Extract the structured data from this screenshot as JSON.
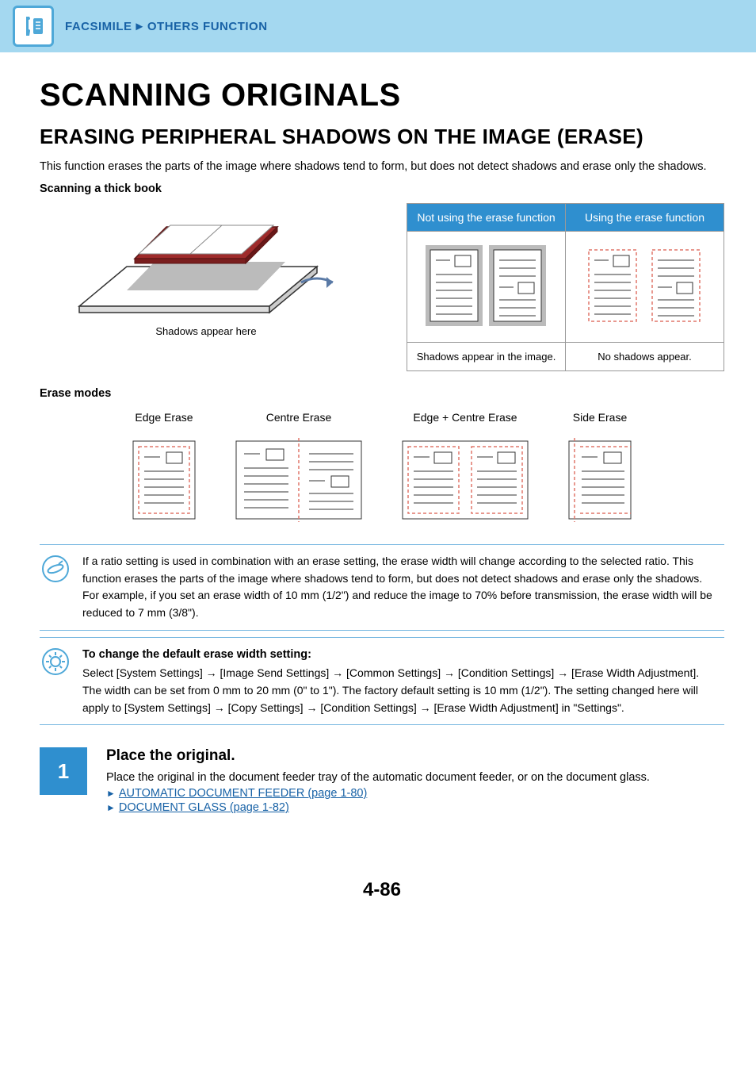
{
  "header": {
    "breadcrumb_section": "FACSIMILE",
    "breadcrumb_sep": "►",
    "breadcrumb_sub": "OTHERS FUNCTION"
  },
  "title_main": "SCANNING ORIGINALS",
  "title_sub": "ERASING PERIPHERAL SHADOWS ON THE IMAGE (ERASE)",
  "intro_paragraph": "This function erases the parts of the image where shadows tend to form, but does not detect shadows and erase only the shadows.",
  "scanning_caption": "Scanning a thick book",
  "book_caption": "Shadows appear here",
  "compare": {
    "col_a_title": "Not using the erase function",
    "col_b_title": "Using the erase function",
    "col_a_caption": "Shadows appear in the image.",
    "col_b_caption": "No shadows appear."
  },
  "erase_modes_label": "Erase modes",
  "modes": {
    "edge": "Edge Erase",
    "centre": "Centre Erase",
    "edge_centre": "Edge + Centre Erase",
    "side": "Side Erase"
  },
  "note1": {
    "p1": "If a ratio setting is used in combination with an erase setting, the erase width will change according to the selected ratio. This function erases the parts of the image where shadows tend to form, but does not detect shadows and erase only the shadows.",
    "p2": "For example, if you set an erase width of 10 mm (1/2\") and reduce the image to 70% before transmission, the erase width will be reduced to 7 mm (3/8\")."
  },
  "note2": {
    "heading": "To change the default erase width setting:",
    "p1": "Select [System Settings] → [Image Send Settings] → [Common Settings] → [Condition Settings] → [Erase Width Adjustment].",
    "p2": "The width can be set from 0 mm to 20 mm (0\" to 1\"). The factory default setting is 10 mm (1/2\"). The setting changed here will apply to [System Settings] → [Copy Settings] → [Condition Settings] → [Erase Width Adjustment] in \"Settings\"."
  },
  "step1": {
    "num": "1",
    "title": "Place the original.",
    "body": "Place the original in the document feeder tray of the automatic document feeder, or on the document glass.",
    "link1": "AUTOMATIC DOCUMENT FEEDER (page 1-80)",
    "link2": "DOCUMENT GLASS (page 1-82)"
  },
  "page_number": "4-86"
}
